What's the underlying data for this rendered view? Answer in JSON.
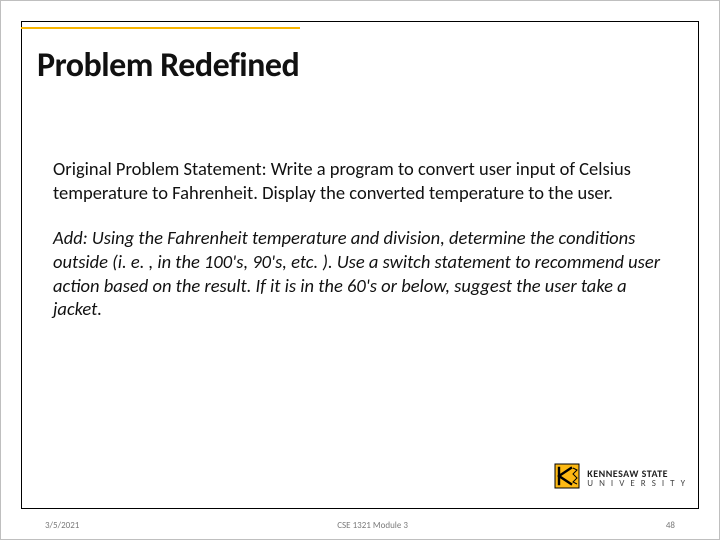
{
  "title": "Problem Redefined",
  "para1": "Original Problem Statement: Write a program to convert user input of Celsius temperature to Fahrenheit.  Display the converted temperature to the user.",
  "para2": "Add: Using the Fahrenheit temperature and division, determine the conditions outside (i. e. , in the 100's, 90's, etc. ).  Use a switch statement to recommend user action based on the result.  If it is in the 60's or below, suggest the user take a jacket.",
  "logo": {
    "line1": "KENNESAW STATE",
    "line2": "U N I V E R S I T Y"
  },
  "footer": {
    "date": "3/5/2021",
    "course": "CSE 1321 Module 3",
    "page": "48"
  }
}
